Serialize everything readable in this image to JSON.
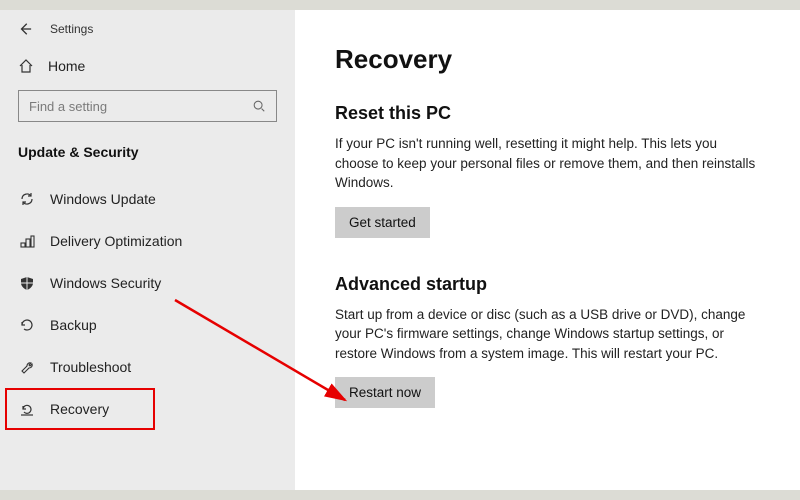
{
  "titlebar": {
    "label": "Settings"
  },
  "home": {
    "label": "Home"
  },
  "search": {
    "placeholder": "Find a setting"
  },
  "section": {
    "label": "Update & Security"
  },
  "nav": {
    "items": [
      {
        "label": "Windows Update"
      },
      {
        "label": "Delivery Optimization"
      },
      {
        "label": "Windows Security"
      },
      {
        "label": "Backup"
      },
      {
        "label": "Troubleshoot"
      },
      {
        "label": "Recovery"
      }
    ]
  },
  "page": {
    "title": "Recovery",
    "reset": {
      "heading": "Reset this PC",
      "body": "If your PC isn't running well, resetting it might help. This lets you choose to keep your personal files or remove them, and then reinstalls Windows.",
      "button": "Get started"
    },
    "advanced": {
      "heading": "Advanced startup",
      "body": "Start up from a device or disc (such as a USB drive or DVD), change your PC's firmware settings, change Windows startup settings, or restore Windows from a system image. This will restart your PC.",
      "button": "Restart now"
    }
  }
}
